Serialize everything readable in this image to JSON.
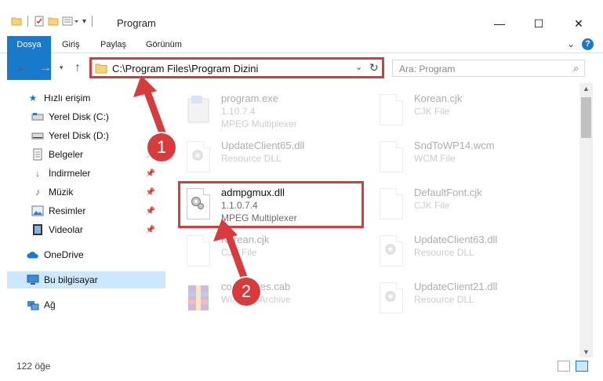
{
  "window": {
    "title": "Program",
    "minimize_glyph": "—",
    "maximize_glyph": "☐",
    "close_glyph": "✕"
  },
  "ribbon": {
    "tabs": [
      "Dosya",
      "Giriş",
      "Paylaş",
      "Görünüm"
    ],
    "help": "?"
  },
  "navigation": {
    "address": "C:\\Program Files\\Program Dizini",
    "search_placeholder": "Ara: Program"
  },
  "sidebar": {
    "quick_access": "Hızlı erişim",
    "items": [
      {
        "label": "Yerel Disk (C:)",
        "icon": "drive-icon",
        "pinned": false
      },
      {
        "label": "Yerel Disk (D:)",
        "icon": "drive-icon",
        "pinned": false
      },
      {
        "label": "Belgeler",
        "icon": "documents-icon",
        "pinned": true
      },
      {
        "label": "İndirmeler",
        "icon": "download-icon",
        "pinned": true
      },
      {
        "label": "Müzik",
        "icon": "music-icon",
        "pinned": true
      },
      {
        "label": "Resimler",
        "icon": "pictures-icon",
        "pinned": true
      },
      {
        "label": "Videolar",
        "icon": "videos-icon",
        "pinned": true
      }
    ],
    "onedrive": "OneDrive",
    "this_pc": "Bu bilgisayar",
    "network": "Ağ"
  },
  "files": [
    {
      "name": "program.exe",
      "line2": "1.10.7.4",
      "line3": "MPEG Multiplexer",
      "icon": "exe-icon",
      "faded": true
    },
    {
      "name": "Korean.cjk",
      "line2": "CJK File",
      "line3": "",
      "icon": "blank-doc-icon",
      "faded": true
    },
    {
      "name": "UpdateClient65.dll",
      "line2": "Resource DLL",
      "line3": "",
      "icon": "dll-icon",
      "faded": true
    },
    {
      "name": "SndToWP14.wcm",
      "line2": "WCM File",
      "line3": "",
      "icon": "blank-doc-icon",
      "faded": true
    },
    {
      "name": "admpgmux.dll",
      "line2": "1.1.0.7.4",
      "line3": "MPEG Multiplexer",
      "icon": "dll-icon",
      "faded": false
    },
    {
      "name": "DefaultFont.cjk",
      "line2": "CJK File",
      "line3": "",
      "icon": "blank-doc-icon",
      "faded": true
    },
    {
      "name": "Korean.cjk",
      "line2": "CJK File",
      "line3": "",
      "icon": "blank-doc-icon",
      "faded": true
    },
    {
      "name": "UpdateClient63.dll",
      "line2": "Resource DLL",
      "line3": "",
      "icon": "dll-icon",
      "faded": true
    },
    {
      "name": "codepages.cab",
      "line2": "WinRAR Archive",
      "line3": "",
      "icon": "archive-icon",
      "faded": true
    },
    {
      "name": "UpdateClient21.dll",
      "line2": "Resource DLL",
      "line3": "",
      "icon": "dll-icon",
      "faded": true
    }
  ],
  "status": {
    "item_count": "122 öğe"
  },
  "callouts": [
    "1",
    "2"
  ],
  "colors": {
    "accent": "#1979ca",
    "highlight": "#d83b3b",
    "selection": "#cce8ff"
  }
}
